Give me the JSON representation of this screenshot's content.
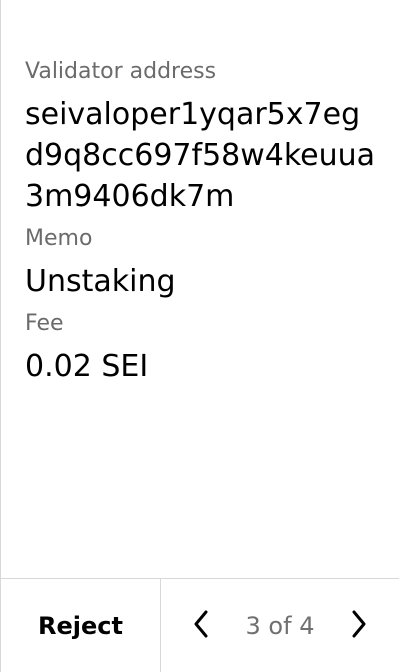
{
  "fields": [
    {
      "label": "Validator address",
      "value": "seivaloper1yqar5x7egd9q8cc697f58w4keuua3m9406dk7m"
    },
    {
      "label": "Memo",
      "value": "Unstaking"
    },
    {
      "label": "Fee",
      "value": "0.02 SEI"
    }
  ],
  "footer": {
    "reject_label": "Reject",
    "page_indicator": "3 of 4",
    "prev_icon": "chevron-left-icon",
    "next_icon": "chevron-right-icon"
  },
  "colors": {
    "label": "#6b6b6b",
    "value": "#000000",
    "divider": "#d8d8d8",
    "indicator": "#707070"
  }
}
